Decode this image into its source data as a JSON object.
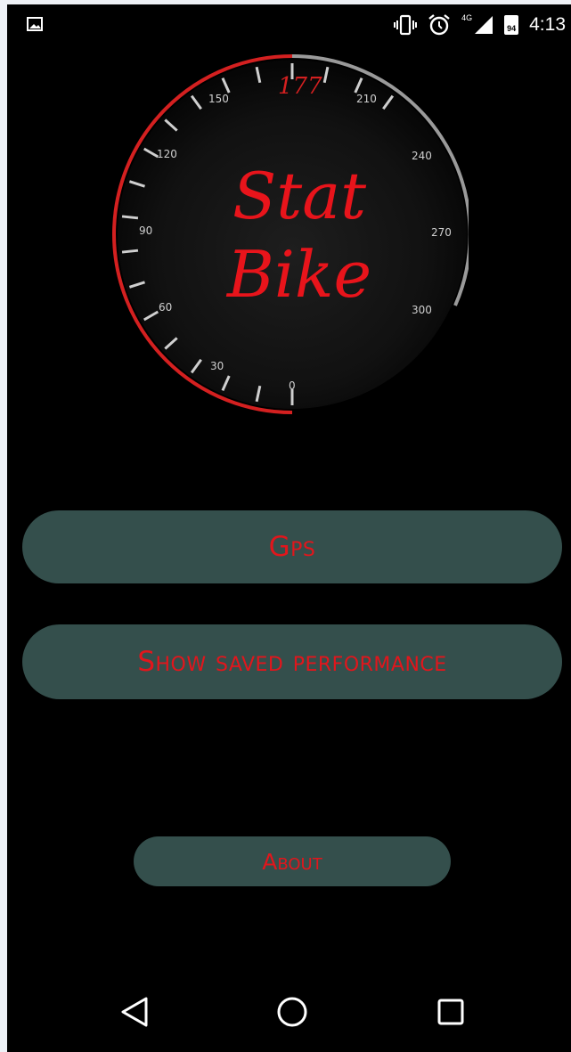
{
  "status_bar": {
    "time": "4:13",
    "battery": "94",
    "network": "4G",
    "icons": [
      "image-notification-icon",
      "vibrate-icon",
      "alarm-icon",
      "signal-icon",
      "battery-icon"
    ]
  },
  "logo": {
    "line1": "Stat",
    "line2": "Bike",
    "speed_reading": "177",
    "ticks": [
      "0",
      "30",
      "60",
      "90",
      "120",
      "150",
      "210",
      "240",
      "270",
      "300"
    ]
  },
  "buttons": {
    "gps": "Gps",
    "saved": "Show saved performance",
    "about": "About"
  },
  "colors": {
    "accent": "#e1161c",
    "button_bg": "#344f4c",
    "background": "#000000"
  },
  "nav": {
    "icons": [
      "back-icon",
      "home-icon",
      "recent-apps-icon"
    ]
  }
}
